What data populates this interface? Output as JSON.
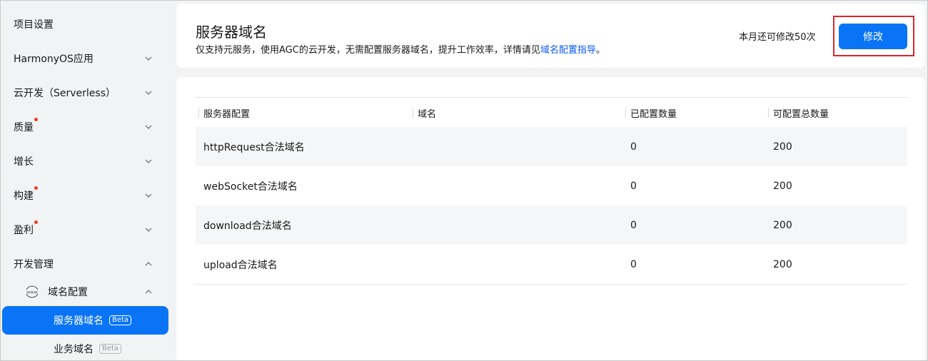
{
  "sidebar": {
    "project_settings": "项目设置",
    "items": [
      {
        "label": "HarmonyOS应用",
        "dot": false,
        "expanded": false
      },
      {
        "label": "云开发（Serverless）",
        "dot": false,
        "expanded": false
      },
      {
        "label": "质量",
        "dot": true,
        "expanded": false
      },
      {
        "label": "增长",
        "dot": false,
        "expanded": false
      },
      {
        "label": "构建",
        "dot": true,
        "expanded": false
      },
      {
        "label": "盈利",
        "dot": true,
        "expanded": false
      },
      {
        "label": "开发管理",
        "dot": false,
        "expanded": true
      }
    ],
    "domain_config": {
      "label": "域名配置",
      "icon": "www-icon",
      "expanded": true
    },
    "leaves": [
      {
        "label": "服务器域名",
        "badge": "Beta",
        "active": true
      },
      {
        "label": "业务域名",
        "badge": "Beta",
        "active": false
      }
    ]
  },
  "header": {
    "title": "服务器域名",
    "desc_prefix": "仅支持元服务，使用AGC的云开发，无需配置服务器域名，提升工作效率，详情请见",
    "desc_link": "域名配置指导",
    "desc_suffix": "。",
    "quota": "本月还可修改50次",
    "edit_label": "修改"
  },
  "table": {
    "columns": [
      "服务器配置",
      "域名",
      "已配置数量",
      "可配置总数量"
    ],
    "rows": [
      [
        "httpRequest合法域名",
        "",
        "0",
        "200"
      ],
      [
        "webSocket合法域名",
        "",
        "0",
        "200"
      ],
      [
        "download合法域名",
        "",
        "0",
        "200"
      ],
      [
        "upload合法域名",
        "",
        "0",
        "200"
      ]
    ]
  },
  "colors": {
    "primary": "#0a74f7",
    "link": "#0a59f7",
    "dot": "#e84026",
    "highlight": "#d9262c"
  }
}
